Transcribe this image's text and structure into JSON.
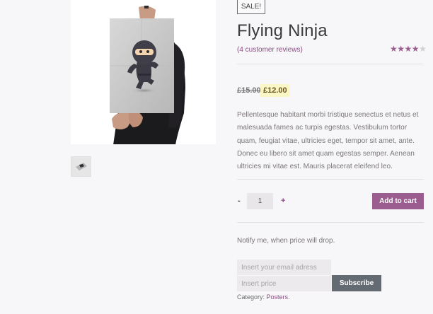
{
  "product": {
    "sale_badge": "SALE!",
    "title": "Flying Ninja",
    "reviews_text": "(4 customer reviews)",
    "rating": {
      "value": 4,
      "max": 5
    },
    "price_regular": "£15.00",
    "price_sale": "£12.00",
    "description": "Pellentesque habitant morbi tristique senectus et netus et malesuada fames ac turpis egestas. Vestibulum tortor quam, feugiat vitae, ultricies eget, tempor sit amet, ante. Donec eu libero sit amet quam egestas semper. Aenean ultricies mi vitae est. Mauris placerat eleifend leo."
  },
  "cart": {
    "minus_label": "-",
    "quantity": "1",
    "plus_label": "+",
    "add_to_cart_label": "Add to cart"
  },
  "notify": {
    "text": "Notify me, when price will drop.",
    "email_placeholder": "Insert your email adress",
    "price_placeholder": "Insert price",
    "subscribe_label": "Subscribe"
  },
  "meta": {
    "category_label": "Category:",
    "category_value": "Posters",
    "category_suffix": "."
  },
  "colors": {
    "accent": "#9b5c8f",
    "link": "#8a4d84",
    "sale_highlight": "#fbf6c6",
    "subscribe_button": "#646a71"
  },
  "icons": {
    "star_filled": "★",
    "star_empty": "★"
  }
}
